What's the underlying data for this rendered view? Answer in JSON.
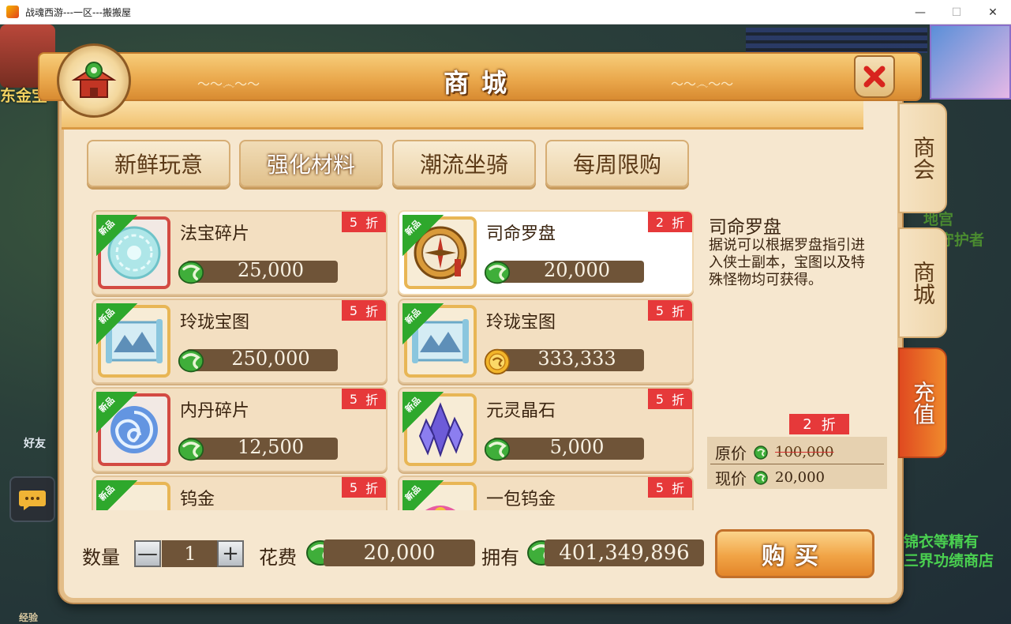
{
  "window": {
    "title": "战魂西游---一区---搬搬屋",
    "min": "—",
    "max": "☐",
    "close": "✕"
  },
  "background": {
    "left_banner": "东金宝",
    "right_labels": [
      "地宫",
      "守护者",
      "锦衣等精有",
      "三界功绩商店"
    ],
    "friends": "好友",
    "exp": "经验"
  },
  "shop": {
    "title": "商城",
    "tabs": [
      "新鲜玩意",
      "强化材料",
      "潮流坐骑",
      "每周限购"
    ],
    "active_tab": 1,
    "side_tabs": [
      "商会",
      "商城",
      "充值"
    ],
    "new_badge": "新品",
    "discount_suffix": "折",
    "items": [
      {
        "name": "法宝碎片",
        "discount": "5",
        "price": "25,000",
        "currency": "jade",
        "frame": "red",
        "art": "orb"
      },
      {
        "name": "司命罗盘",
        "discount": "2",
        "price": "20,000",
        "currency": "jade",
        "frame": "gold",
        "art": "compass",
        "selected": true
      },
      {
        "name": "玲珑宝图",
        "discount": "5",
        "price": "250,000",
        "currency": "jade",
        "frame": "gold",
        "art": "map"
      },
      {
        "name": "玲珑宝图",
        "discount": "5",
        "price": "333,333",
        "currency": "gold",
        "frame": "gold",
        "art": "map"
      },
      {
        "name": "内丹碎片",
        "discount": "5",
        "price": "12,500",
        "currency": "jade",
        "frame": "red",
        "art": "swirl"
      },
      {
        "name": "元灵晶石",
        "discount": "5",
        "price": "5,000",
        "currency": "jade",
        "frame": "gold",
        "art": "crystal"
      },
      {
        "name": "钨金",
        "discount": "5",
        "price": "",
        "currency": "jade",
        "frame": "gold",
        "art": "ore"
      },
      {
        "name": "一包钨金",
        "discount": "5",
        "price": "",
        "currency": "jade",
        "frame": "gold",
        "art": "pack"
      }
    ],
    "detail": {
      "name": "司命罗盘",
      "description": "据说可以根据罗盘指引进入侠士副本，宝图以及特殊怪物均可获得。",
      "discount": "2",
      "original_label": "原价",
      "original_price": "100,000",
      "current_label": "现价",
      "current_price": "20,000"
    },
    "bottom": {
      "qty_label": "数量",
      "qty_value": "1",
      "minus": "—",
      "plus": "+",
      "cost_label": "花费",
      "cost_value": "20,000",
      "own_label": "拥有",
      "own_value": "401,349,896",
      "buy_label": "购买"
    }
  },
  "colors": {
    "panel": "#f6e7cf",
    "discount_red": "#e6393a",
    "price_bar": "#6f5438",
    "jade": "#3fae3a",
    "gold": "#e8a820"
  }
}
